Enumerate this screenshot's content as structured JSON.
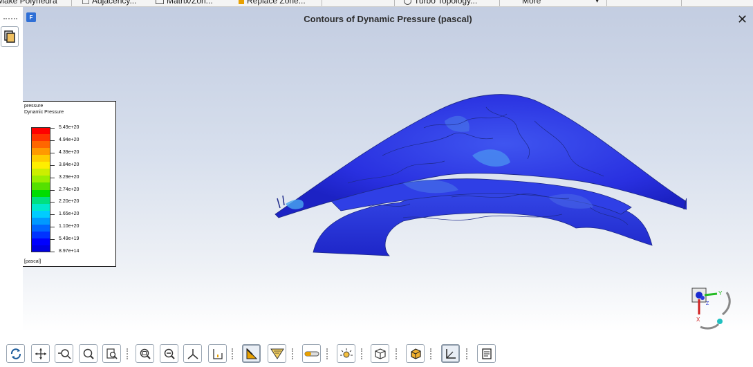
{
  "topbar": {
    "items": [
      {
        "label": "Make Polyhedra",
        "icon": "polyhedra-icon"
      },
      {
        "label": "Adjacency...",
        "icon": "adjacency-icon"
      },
      {
        "label": "Matrix/Zon...",
        "icon": "matrix-icon"
      },
      {
        "label": "Replace Zone...",
        "icon": "replace-zone-icon"
      },
      {
        "label": "Turbo Topology...",
        "icon": "turbo-topology-icon"
      },
      {
        "label": "More",
        "icon": "chevron-down-icon"
      }
    ]
  },
  "viewport": {
    "logo": "F",
    "title": "Contours of Dynamic Pressure (pascal)",
    "close_label": "✕",
    "background_top": "#c3cde1",
    "background_bottom": "#ffffff"
  },
  "legend": {
    "line1": "pressure",
    "line2": "Dynamic Pressure",
    "unit": "[pascal]",
    "labels": [
      "5.49e+20",
      "4.94e+20",
      "4.39e+20",
      "3.84e+20",
      "3.29e+20",
      "2.74e+20",
      "2.20e+20",
      "1.65e+20",
      "1.10e+20",
      "5.49e+19",
      "8.97e+14"
    ],
    "colors": [
      "#ff0000",
      "#ff3300",
      "#ff6600",
      "#ff9900",
      "#ffcc00",
      "#ffee00",
      "#ccee00",
      "#99ee00",
      "#55e000",
      "#00dd00",
      "#00e080",
      "#00e8cc",
      "#00ccff",
      "#0099ff",
      "#0066ff",
      "#0033ff",
      "#0000ff",
      "#0000e0"
    ]
  },
  "model": {
    "outer_color": "#2a2ee0",
    "inner_color": "#2530cc",
    "highlight_color": "#4aa8f0",
    "contour_color": "#1e2a8a"
  },
  "triad": {
    "x_label": "X",
    "y_label": "Y",
    "z_label": "Z"
  },
  "toolbar": {
    "buttons": [
      {
        "icon": "rotate-icon",
        "active": true
      },
      {
        "icon": "pan-icon",
        "active": false
      },
      {
        "icon": "zoom-in-out-icon",
        "active": false
      },
      {
        "icon": "zoom-icon",
        "active": false
      },
      {
        "icon": "zoom-to-box-icon",
        "active": false
      },
      {
        "icon": "zoom-fit-icon",
        "active": false
      },
      {
        "icon": "zoom-out-icon",
        "active": false
      },
      {
        "icon": "axis-view-icon",
        "active": false
      },
      {
        "icon": "reset-view-icon",
        "active": false
      },
      {
        "icon": "probe-icon",
        "active": true
      },
      {
        "icon": "filter-icon",
        "active": false
      },
      {
        "icon": "transparency-icon",
        "active": false
      },
      {
        "icon": "lighting-icon",
        "active": false
      },
      {
        "icon": "cube-view-icon",
        "active": false
      },
      {
        "icon": "box-select-icon",
        "active": false
      },
      {
        "icon": "axes-toggle-icon",
        "active": true
      },
      {
        "icon": "notes-icon",
        "active": false
      }
    ]
  }
}
